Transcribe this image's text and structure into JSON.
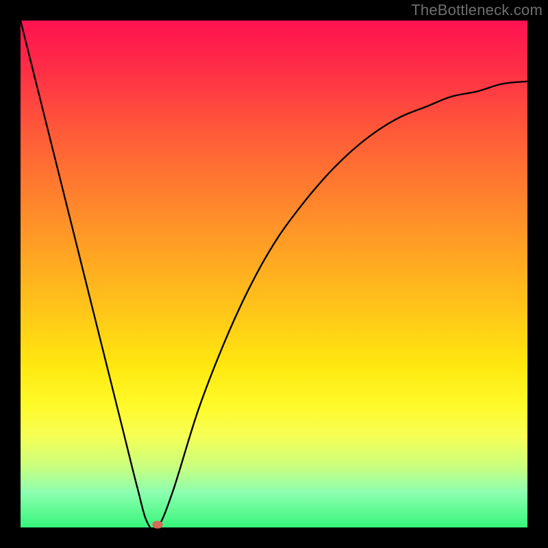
{
  "watermark": "TheBottleneck.com",
  "colors": {
    "frame": "#000000",
    "watermark_text": "#6f6f6f",
    "curve": "#000000",
    "marker": "#d56a59",
    "gradient_top": "#ff1250",
    "gradient_bottom": "#36f57a"
  },
  "chart_data": {
    "type": "line",
    "title": "",
    "xlabel": "",
    "ylabel": "",
    "xlim": [
      0,
      100
    ],
    "ylim": [
      0,
      100
    ],
    "grid": false,
    "legend": false,
    "series": [
      {
        "name": "bottleneck-curve",
        "x": [
          0,
          5,
          10,
          15,
          20,
          23,
          25,
          27,
          30,
          35,
          40,
          45,
          50,
          55,
          60,
          65,
          70,
          75,
          80,
          85,
          90,
          95,
          100
        ],
        "y": [
          100,
          80,
          60,
          40,
          20,
          8,
          1,
          0,
          7,
          23,
          36,
          47,
          56,
          63,
          69,
          74,
          78,
          81,
          83,
          85,
          86,
          87.5,
          88
        ]
      }
    ],
    "marker": {
      "x": 27,
      "y": 0.5
    }
  }
}
